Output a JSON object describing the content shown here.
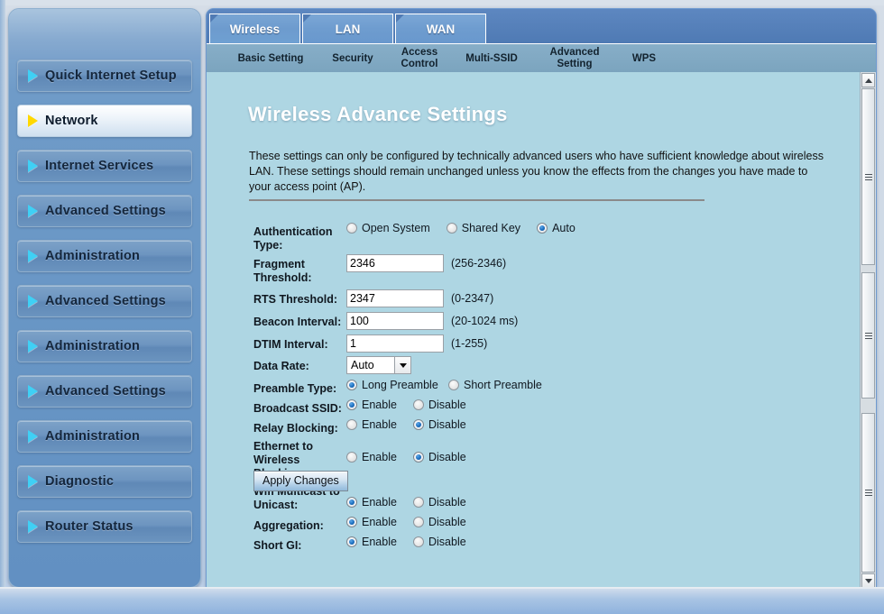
{
  "sidebar": {
    "items": [
      {
        "label": "Quick Internet Setup",
        "active": false,
        "icon": "triangle-right-icon"
      },
      {
        "label": "Network",
        "active": true,
        "icon": "triangle-right-icon"
      },
      {
        "label": "Internet Services",
        "active": false,
        "icon": "triangle-right-icon"
      },
      {
        "label": "Advanced Settings",
        "active": false,
        "icon": "triangle-right-icon"
      },
      {
        "label": "Administration",
        "active": false,
        "icon": "triangle-right-icon"
      },
      {
        "label": "Advanced Settings",
        "active": false,
        "icon": "triangle-right-icon"
      },
      {
        "label": "Administration",
        "active": false,
        "icon": "triangle-right-icon"
      },
      {
        "label": "Advanced Settings",
        "active": false,
        "icon": "triangle-right-icon"
      },
      {
        "label": "Administration",
        "active": false,
        "icon": "triangle-right-icon"
      },
      {
        "label": "Diagnostic",
        "active": false,
        "icon": "triangle-right-icon"
      },
      {
        "label": "Router Status",
        "active": false,
        "icon": "triangle-right-icon"
      }
    ]
  },
  "tabs": [
    {
      "label": "Wireless",
      "active": true
    },
    {
      "label": "LAN",
      "active": false
    },
    {
      "label": "WAN",
      "active": false
    }
  ],
  "subtabs": [
    {
      "label": "Basic Setting",
      "active": false
    },
    {
      "label": "Security",
      "active": false
    },
    {
      "label": "Access Control",
      "active": false
    },
    {
      "label": "Multi-SSID",
      "active": false
    },
    {
      "label": "Advanced Setting",
      "active": true
    },
    {
      "label": "WPS",
      "active": false
    }
  ],
  "page": {
    "title": "Wireless Advance Settings",
    "description": "These settings can only be configured by technically advanced users who have sufficient knowledge about wireless LAN. These settings should remain unchanged unless you know the effects from the changes you have made to your access point (AP)."
  },
  "form": {
    "auth_type": {
      "label": "Authentication Type:",
      "options": [
        {
          "label": "Open System",
          "selected": false
        },
        {
          "label": "Shared Key",
          "selected": false
        },
        {
          "label": "Auto",
          "selected": true
        }
      ]
    },
    "fragment_threshold": {
      "label": "Fragment Threshold:",
      "value": "2346",
      "hint": "(256-2346)"
    },
    "rts_threshold": {
      "label": "RTS Threshold:",
      "value": "2347",
      "hint": "(0-2347)"
    },
    "beacon_interval": {
      "label": "Beacon Interval:",
      "value": "100",
      "hint": "(20-1024 ms)"
    },
    "dtim_interval": {
      "label": "DTIM Interval:",
      "value": "1",
      "hint": "(1-255)"
    },
    "data_rate": {
      "label": "Data Rate:",
      "value": "Auto"
    },
    "preamble_type": {
      "label": "Preamble Type:",
      "options": [
        {
          "label": "Long Preamble",
          "selected": true
        },
        {
          "label": "Short Preamble",
          "selected": false
        }
      ]
    },
    "broadcast_ssid": {
      "label": "Broadcast SSID:",
      "options": [
        {
          "label": "Enable",
          "selected": true
        },
        {
          "label": "Disable",
          "selected": false
        }
      ]
    },
    "relay_blocking": {
      "label": "Relay Blocking:",
      "options": [
        {
          "label": "Enable",
          "selected": false
        },
        {
          "label": "Disable",
          "selected": true
        }
      ]
    },
    "eth_to_wireless_blocking": {
      "label": "Ethernet to Wireless Blocking:",
      "options": [
        {
          "label": "Enable",
          "selected": false
        },
        {
          "label": "Disable",
          "selected": true
        }
      ]
    },
    "wifi_multicast_to_unicast": {
      "label": "Wifi Multicast to Unicast:",
      "options": [
        {
          "label": "Enable",
          "selected": true
        },
        {
          "label": "Disable",
          "selected": false
        }
      ]
    },
    "aggregation": {
      "label": "Aggregation:",
      "options": [
        {
          "label": "Enable",
          "selected": true
        },
        {
          "label": "Disable",
          "selected": false
        }
      ]
    },
    "short_gi": {
      "label": "Short GI:",
      "options": [
        {
          "label": "Enable",
          "selected": true
        },
        {
          "label": "Disable",
          "selected": false
        }
      ]
    },
    "apply_button": "Apply Changes"
  },
  "colors": {
    "content_bg": "#aed6e3",
    "panel_blue": "#5580bc",
    "subtab_bar": "#87aec8",
    "sidebar_blue": "#6694c4",
    "accent_arrow": "#3fd0f5",
    "active_arrow": "#ffd800",
    "radio_selected": "#1c6fc0"
  }
}
